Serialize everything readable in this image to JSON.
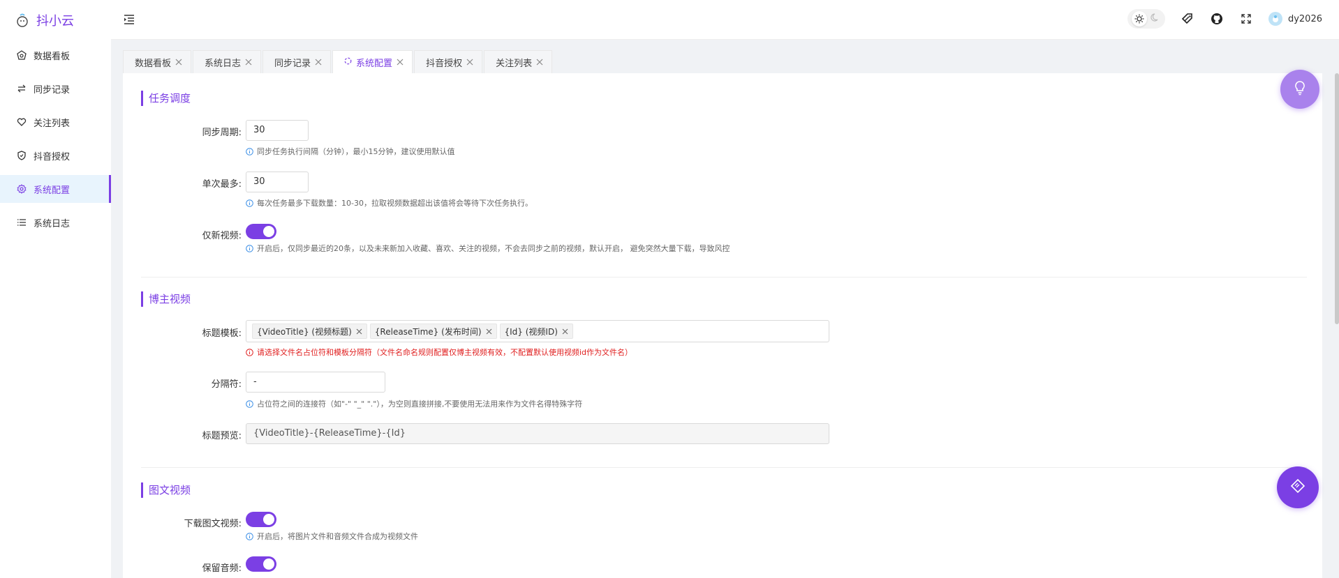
{
  "brand": {
    "title": "抖小云",
    "logo_icon": "cloud-mascot-icon"
  },
  "sidebar": {
    "items": [
      {
        "label": "数据看板",
        "icon": "dashboard-icon",
        "active": false
      },
      {
        "label": "同步记录",
        "icon": "sync-icon",
        "active": false
      },
      {
        "label": "关注列表",
        "icon": "heart-icon",
        "active": false
      },
      {
        "label": "抖音授权",
        "icon": "shield-icon",
        "active": false
      },
      {
        "label": "系统配置",
        "icon": "gear-icon",
        "active": true
      },
      {
        "label": "系统日志",
        "icon": "list-icon",
        "active": false
      }
    ]
  },
  "header": {
    "collapse_icon": "menu-collapse-icon",
    "user_name": "dy2026",
    "icons": [
      "sun-icon",
      "moon-icon",
      "tag-icon",
      "github-icon",
      "fullscreen-icon"
    ]
  },
  "tabs": [
    {
      "label": "数据看板",
      "active": false
    },
    {
      "label": "系统日志",
      "active": false
    },
    {
      "label": "同步记录",
      "active": false
    },
    {
      "label": "系统配置",
      "active": true
    },
    {
      "label": "抖音授权",
      "active": false
    },
    {
      "label": "关注列表",
      "active": false
    }
  ],
  "sections": {
    "task": {
      "title": "任务调度",
      "sync_period": {
        "label": "同步周期:",
        "value": "30",
        "hint": "同步任务执行间隔（分钟），最小15分钟，建议使用默认值"
      },
      "max_per_run": {
        "label": "单次最多:",
        "value": "30",
        "hint": "每次任务最多下载数量：10-30，拉取视频数据超出该值将会等待下次任务执行。"
      },
      "only_new": {
        "label": "仅新视频:",
        "enabled": true,
        "hint": "开启后，仅同步最近的20条，以及未来新加入收藏、喜欢、关注的视频，不会去同步之前的视频，默认开启， 避免突然大量下载，导致风控"
      }
    },
    "blogger": {
      "title": "博主视频",
      "title_template": {
        "label": "标题模板:",
        "tags": [
          "{VideoTitle} (视频标题)",
          "{ReleaseTime} (发布时间)",
          "{Id} (视频ID)"
        ],
        "hint": "请选择文件名占位符和模板分隔符（文件名命名规则配置仅博主视频有效，不配置默认使用视频id作为文件名）"
      },
      "separator": {
        "label": "分隔符:",
        "value": "-",
        "hint": "占位符之间的连接符（如\"-\" \"_\" \".\"），为空则直接拼接,不要使用无法用来作为文件名得特殊字符"
      },
      "preview": {
        "label": "标题预览:",
        "value": "{VideoTitle}-{ReleaseTime}-{Id}"
      }
    },
    "image_video": {
      "title": "图文视频",
      "download": {
        "label": "下载图文视频:",
        "enabled": true,
        "hint": "开启后，将图片文件和音频文件合成为视频文件"
      },
      "keep_audio": {
        "label": "保留音频:",
        "enabled": true
      }
    }
  },
  "fabs": {
    "tips_icon": "lightbulb-icon",
    "theme_icon": "palette-icon"
  },
  "colors": {
    "accent": "#7b3fe4",
    "error": "#e02020",
    "active_bg": "#e8f4fd"
  }
}
